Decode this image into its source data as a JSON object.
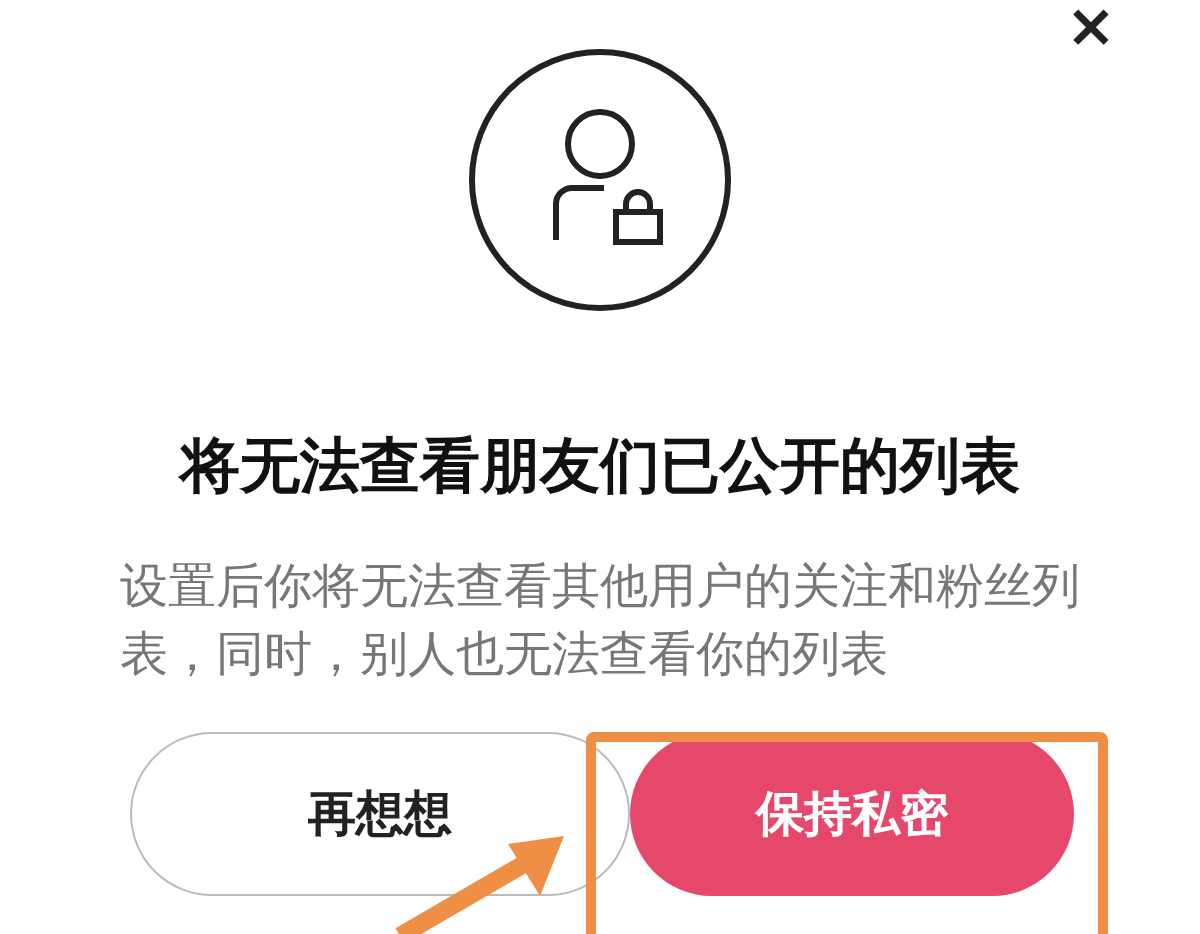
{
  "close_button": {
    "label": "×"
  },
  "dialog": {
    "title": "将无法查看朋友们已公开的列表",
    "message": "设置后你将无法查看其他用户的关注和粉丝列表，同时，别人也无法查看你的列表"
  },
  "buttons": [
    {
      "label": "再想想",
      "kind": "secondary"
    },
    {
      "label": "保持私密",
      "kind": "primary"
    }
  ]
}
